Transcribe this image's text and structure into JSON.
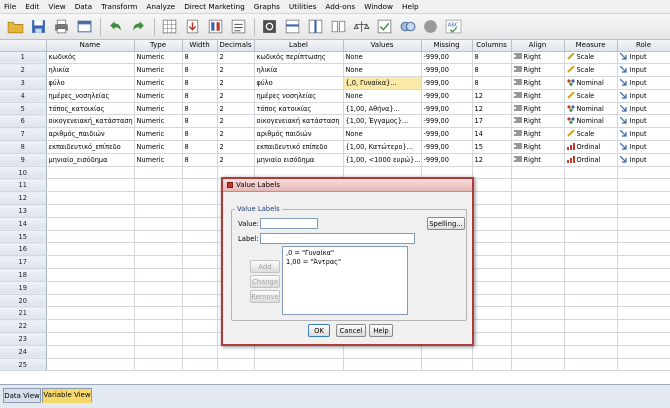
{
  "menu": [
    "File",
    "Edit",
    "View",
    "Data",
    "Transform",
    "Analyze",
    "Direct Marketing",
    "Graphs",
    "Utilities",
    "Add-ons",
    "Window",
    "Help"
  ],
  "columns": [
    "Name",
    "Type",
    "Width",
    "Decimals",
    "Label",
    "Values",
    "Missing",
    "Columns",
    "Align",
    "Measure",
    "Role"
  ],
  "rows": [
    {
      "num": "1",
      "name": "κωδικός",
      "type": "Numeric",
      "width": "8",
      "dec": "2",
      "label": "κωδικός περίπτωσης",
      "values": "None",
      "missing": "-999,00",
      "cols": "8",
      "align": "Right",
      "measure": "Scale",
      "role": "Input"
    },
    {
      "num": "2",
      "name": "ηλικία",
      "type": "Numeric",
      "width": "8",
      "dec": "2",
      "label": "ηλικία",
      "values": "None",
      "missing": "-999,00",
      "cols": "8",
      "align": "Right",
      "measure": "Scale",
      "role": "Input"
    },
    {
      "num": "3",
      "name": "φύλο",
      "type": "Numeric",
      "width": "8",
      "dec": "2",
      "label": "φύλο",
      "values": "{,0, Γυναίκα}...",
      "missing": "-999,00",
      "cols": "8",
      "align": "Right",
      "measure": "Nominal",
      "role": "Input"
    },
    {
      "num": "4",
      "name": "ημέρες_νοσηλείας",
      "type": "Numeric",
      "width": "8",
      "dec": "2",
      "label": "ημέρες νοσηλείας",
      "values": "None",
      "missing": "-999,00",
      "cols": "12",
      "align": "Right",
      "measure": "Scale",
      "role": "Input"
    },
    {
      "num": "5",
      "name": "τόπος_κατοικίας",
      "type": "Numeric",
      "width": "8",
      "dec": "2",
      "label": "τόπος κατοικίας",
      "values": "{1,00, Αθήνα}...",
      "missing": "-999,00",
      "cols": "12",
      "align": "Right",
      "measure": "Nominal",
      "role": "Input"
    },
    {
      "num": "6",
      "name": "οικογενειακή_κατάσταση",
      "type": "Numeric",
      "width": "8",
      "dec": "2",
      "label": "οικογενειακή κατάσταση",
      "values": "{1,00, Έγγαμος}...",
      "missing": "-999,00",
      "cols": "17",
      "align": "Right",
      "measure": "Nominal",
      "role": "Input"
    },
    {
      "num": "7",
      "name": "αριθμός_παιδιών",
      "type": "Numeric",
      "width": "8",
      "dec": "2",
      "label": "αριθμός παιδιών",
      "values": "None",
      "missing": "-999,00",
      "cols": "14",
      "align": "Right",
      "measure": "Scale",
      "role": "Input"
    },
    {
      "num": "8",
      "name": "εκπαιδευτικό_επίπεδο",
      "type": "Numeric",
      "width": "8",
      "dec": "2",
      "label": "εκπαιδευτικό επίπεδο",
      "values": "{1,00, Κατώτερο}...",
      "missing": "-999,00",
      "cols": "15",
      "align": "Right",
      "measure": "Ordinal",
      "role": "Input"
    },
    {
      "num": "9",
      "name": "μηνιαίο_εισόδημα",
      "type": "Numeric",
      "width": "8",
      "dec": "2",
      "label": "μηνιαίο εισόδημα",
      "values": "{1,00, <1000 ευρώ}...",
      "missing": "-999,00",
      "cols": "12",
      "align": "Right",
      "measure": "Ordinal",
      "role": "Input"
    }
  ],
  "empty_rows": [
    "10",
    "11",
    "12",
    "13",
    "14",
    "15",
    "16",
    "17",
    "18",
    "19",
    "20",
    "21",
    "22",
    "23",
    "24",
    "25"
  ],
  "tabs": {
    "data_view": "Data View",
    "variable_view": "Variable View"
  },
  "dialog": {
    "title": "Value Labels",
    "group_label": "Value Labels",
    "value_label": "Value:",
    "label_label": "Label:",
    "spelling": "Spelling...",
    "add": "Add",
    "change": "Change",
    "remove": "Remove",
    "list": [
      ",0 = \"Γυναίκα\"",
      "1,00 = \"Άντρας\""
    ],
    "ok": "OK",
    "cancel": "Cancel",
    "help": "Help"
  },
  "colors": {
    "accent": "#b13b3b",
    "selected_row": "#fbe9a8"
  }
}
